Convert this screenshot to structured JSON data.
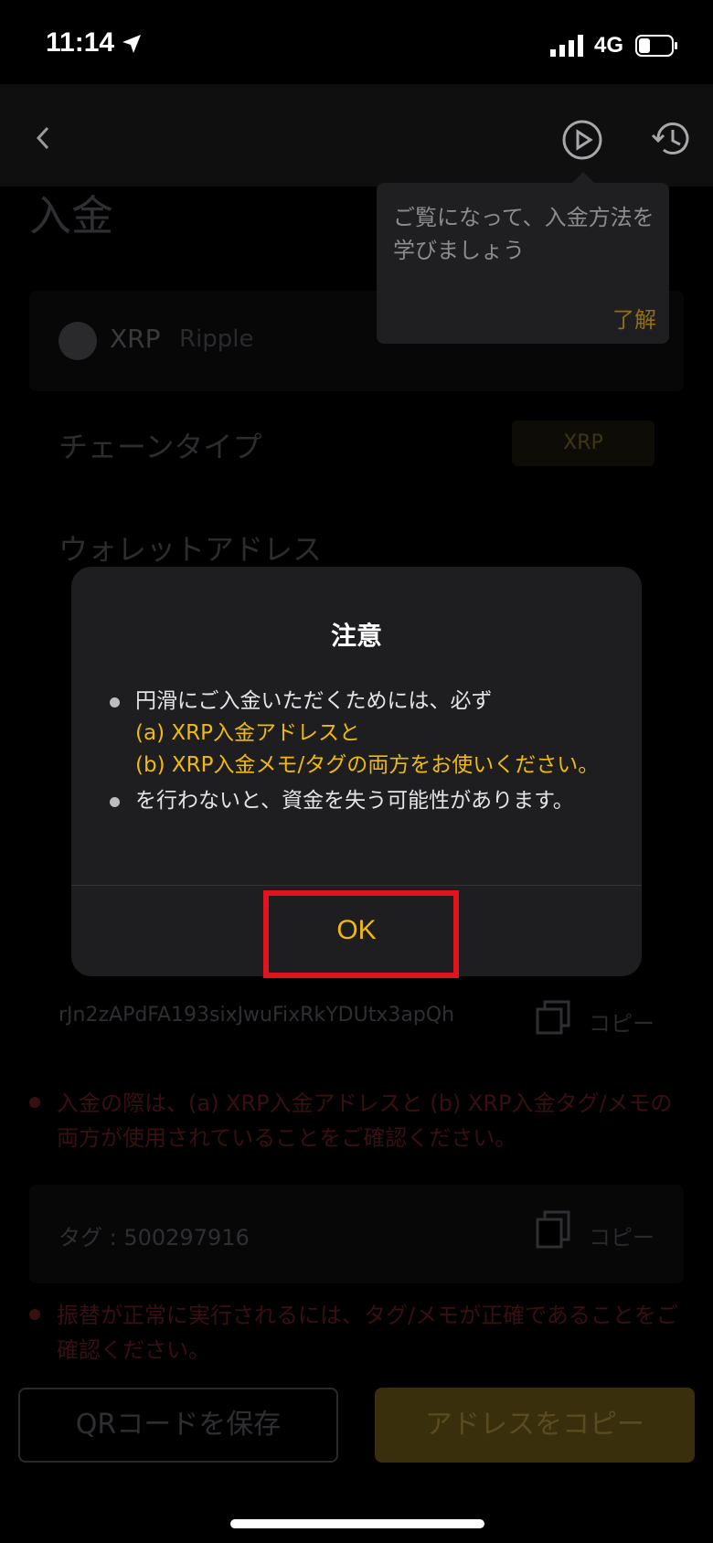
{
  "status_bar": {
    "time": "11:14",
    "network": "4G"
  },
  "header": {
    "back_icon": "chevron-left-icon",
    "play_icon": "play-circle-icon",
    "history_icon": "history-icon"
  },
  "page": {
    "title": "入金",
    "coin": {
      "symbol": "XRP",
      "name": "Ripple"
    },
    "chain_label": "チェーンタイプ",
    "chain_value": "XRP",
    "wallet_label": "ウォレットアドレス",
    "address": "rJn2zAPdFA193sixJwuFixRkYDUtx3apQh",
    "copy_label": "コピー",
    "warning_1": "入金の際は、(a) XRP入金アドレスと (b) XRP入金タグ/メモの両方が使用されていることをご確認ください。",
    "tag": "タグ : 500297916",
    "warning_2": "振替が正常に実行されるには、タグ/メモが正確であることをご確認ください。",
    "btn_save_qr": "QRコードを保存",
    "btn_copy_address": "アドレスをコピー"
  },
  "tooltip": {
    "text": "ご覧になって、入金方法を学びましょう",
    "ok": "了解"
  },
  "modal": {
    "title": "注意",
    "line_1_prefix": "円滑にご入金いただくためには、必ず",
    "line_1_a": "(a) XRP入金アドレスと",
    "line_1_b": "(b) XRP入金メモ/タグの両方をお使いください。",
    "line_2": " を行わないと、資金を失う可能性があります。",
    "ok_label": "OK"
  },
  "colors": {
    "accent": "#f0b90b",
    "highlight": "#e0141e",
    "modal_bg": "#1e1e20"
  }
}
